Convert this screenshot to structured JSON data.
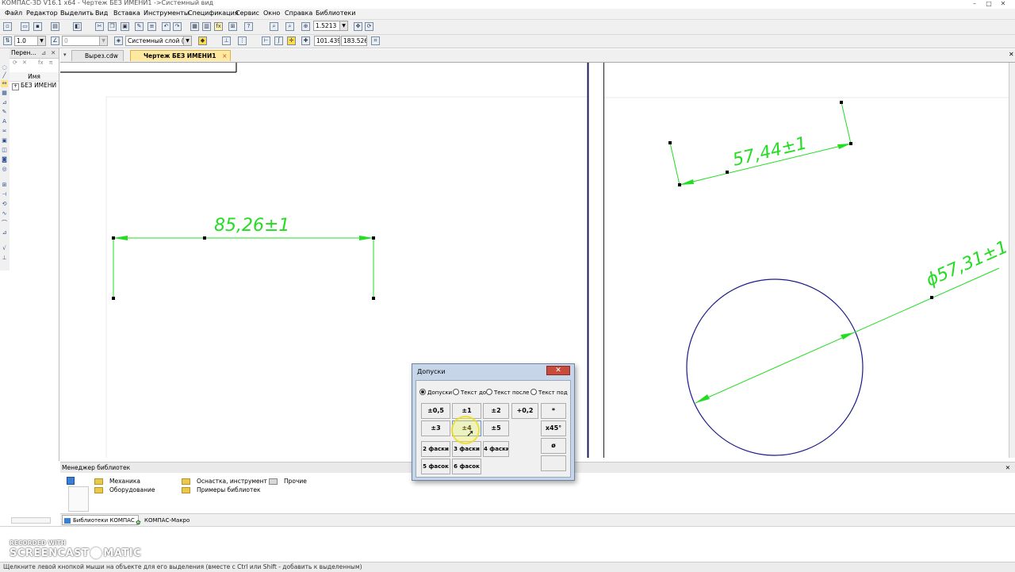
{
  "window": {
    "title": "КОМПАС-3D V16.1 x64 - Чертеж БЕЗ ИМЕНИ1 ->Системный вид"
  },
  "menu": [
    "Файл",
    "Редактор",
    "Выделить",
    "Вид",
    "Вставка",
    "Инструменты",
    "Спецификация",
    "Сервис",
    "Окно",
    "Справка",
    "Библиотеки"
  ],
  "toolbar": {
    "zoom_value": "1.5213"
  },
  "props": {
    "line_step": "1.0",
    "angle": "0",
    "layer": "Системный слой (0)",
    "coord_x": "101.439",
    "coord_y": "183.526"
  },
  "tree": {
    "header": "Перен...",
    "column": "Имя",
    "item": "БЕЗ ИМЕНИ"
  },
  "tabs": [
    {
      "label": "Вырез.cdw"
    },
    {
      "label": "Чертеж БЕЗ ИМЕНИ1",
      "close": "×"
    }
  ],
  "drawing": {
    "dim1": "85,26±1",
    "dim2": "57,44±1",
    "dim3": "ϕ57,31±1",
    "colors": {
      "dimension": "#22dd22",
      "geometry": "#1a1a8a"
    }
  },
  "dialog": {
    "title": "Допуски",
    "close": "✕",
    "radios": [
      {
        "label": "Допуски",
        "checked": true
      },
      {
        "label": "Текст до",
        "checked": false
      },
      {
        "label": "Текст после",
        "checked": false
      },
      {
        "label": "Текст под",
        "checked": false
      }
    ],
    "buttons": {
      "b05": "±0,5",
      "b1": "±1",
      "b2": "±2",
      "b02": "+0,2",
      "star": "*",
      "b3": "±3",
      "b4": "±4",
      "b5": "±5",
      "x45": "x45°",
      "f2": "2 фаски",
      "f3": "3 фаски",
      "f4": "4 фаски",
      "dia": "ø",
      "f5": "5 фасок",
      "f6": "6 фасок",
      "empty": ""
    }
  },
  "library": {
    "header": "Менеджер библиотек",
    "folders": [
      "Механика",
      "Оборудование",
      "Оснастка, инструмент",
      "Примеры библиотек",
      "Прочие"
    ],
    "tabs": [
      "Библиотеки КОМПАС",
      "КОМПАС-Макро"
    ]
  },
  "watermark": {
    "line1": "RECORDED WITH",
    "line2": "SCREENCAST",
    "line3": "MATIC"
  },
  "status": "Щелкните левой кнопкой мыши на объекте для его выделения (вместе с Ctrl или Shift - добавить к выделенным)"
}
